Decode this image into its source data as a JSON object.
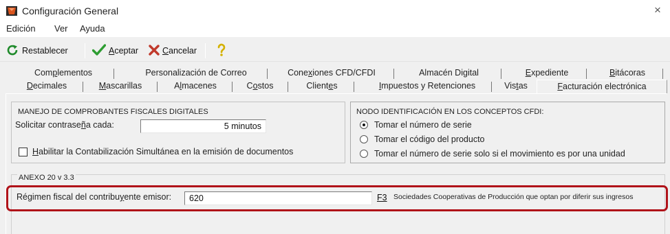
{
  "window": {
    "title": "Configuración General",
    "close_glyph": "×",
    "icon": "app-logo-icon"
  },
  "menu": [
    "Edición",
    "Ver",
    "Ayuda"
  ],
  "toolbar": {
    "restablecer": "Restablecer",
    "aceptar_u": "A",
    "aceptar_rest": "ceptar",
    "cancelar_u": "C",
    "cancelar_rest": "ancelar",
    "icons": {
      "restablecer": "refresh-icon",
      "aceptar": "checkmark-icon",
      "cancelar": "x-mark-icon",
      "help": "help-icon"
    },
    "colors": {
      "restablecer": "#1e8a2a",
      "aceptar": "#2e9d32",
      "cancelar": "#c0392b",
      "help": "#d4b100"
    }
  },
  "tabs_row1": [
    {
      "pre": "Com",
      "u": "p",
      "post": "lementos"
    },
    {
      "pre": "Personalización de Correo",
      "u": "",
      "post": ""
    },
    {
      "pre": "Cone",
      "u": "x",
      "post": "iones CFD/CFDI"
    },
    {
      "pre": "Almacén Digital",
      "u": "",
      "post": ""
    },
    {
      "pre": "",
      "u": "E",
      "post": "xpediente"
    },
    {
      "pre": "",
      "u": "B",
      "post": "itácoras"
    }
  ],
  "tabs_row2": [
    {
      "pre": "",
      "u": "D",
      "post": "ecimales"
    },
    {
      "pre": "",
      "u": "M",
      "post": "ascarillas"
    },
    {
      "pre": "A",
      "u": "l",
      "post": "macenes"
    },
    {
      "pre": "C",
      "u": "o",
      "post": "stos"
    },
    {
      "pre": "Client",
      "u": "e",
      "post": "s"
    },
    {
      "pre": "",
      "u": "I",
      "post": "mpuestos y Retenciones"
    },
    {
      "pre": "Vis",
      "u": "t",
      "post": "as"
    },
    {
      "pre": "",
      "u": "F",
      "post": "acturación electrónica"
    }
  ],
  "manejo": {
    "title": "MANEJO DE COMPROBANTES FISCALES DIGITALES",
    "password_label_pre": "Solicitar contrase",
    "password_label_u": "ñ",
    "password_label_post": "a cada:",
    "password_value": "5 minutos",
    "habilitar_u": "H",
    "habilitar_rest": "abilitar la Contabilización Simultánea en la emisión de documentos",
    "habilitar_checked": false
  },
  "nodo": {
    "title": "NODO IDENTIFICACIÓN EN LOS CONCEPTOS CFDI:",
    "options": [
      "Tomar el número de serie",
      "Tomar el código del producto",
      "Tomar el número de serie solo si el movimiento es por una unidad"
    ],
    "selected_index": 0
  },
  "anexo": {
    "title": "ANEXO 20 v 3.3",
    "regimen_label_pre": "Régimen fiscal del contribu",
    "regimen_label_u": "y",
    "regimen_label_post": "ente emisor:",
    "regimen_value": "620",
    "f3": "F3",
    "description": "Sociedades Cooperativas de Producción que optan por diferir sus ingresos",
    "highlight_color": "#b01219"
  }
}
